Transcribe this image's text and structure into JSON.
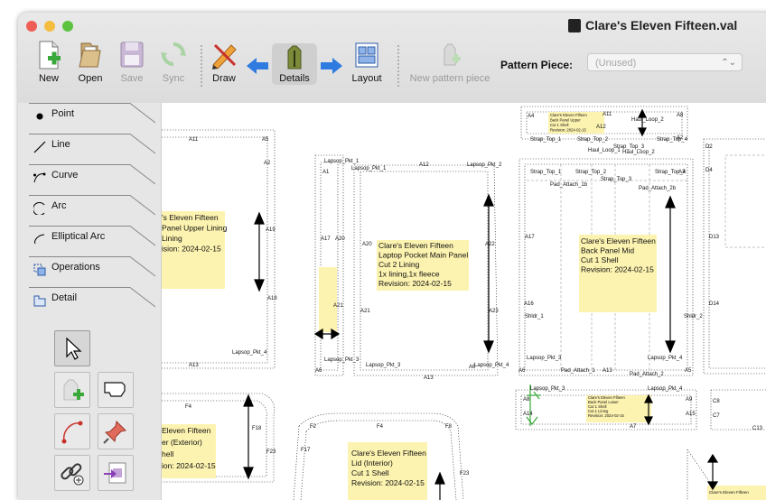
{
  "window": {
    "title": "Clare's Eleven Fifteen.val",
    "traffic": {
      "close": "#ee5e55",
      "minimize": "#f4bd3f",
      "zoom": "#5bc33f"
    }
  },
  "toolbar": {
    "new_label": "New",
    "open_label": "Open",
    "save_label": "Save",
    "sync_label": "Sync",
    "draw_label": "Draw",
    "details_label": "Details",
    "layout_label": "Layout",
    "new_piece_label": "New pattern piece",
    "pattern_piece_label": "Pattern Piece:",
    "pattern_piece_value": "(Unused)",
    "arrow_color": "#2f7be0"
  },
  "sidebar": {
    "tabs": [
      {
        "label": "Point",
        "icon": "point-icon"
      },
      {
        "label": "Line",
        "icon": "line-icon"
      },
      {
        "label": "Curve",
        "icon": "curve-icon"
      },
      {
        "label": "Arc",
        "icon": "arc-icon"
      },
      {
        "label": "Elliptical Arc",
        "icon": "elliptical-arc-icon"
      },
      {
        "label": "Operations",
        "icon": "operations-icon"
      },
      {
        "label": "Detail",
        "icon": "detail-icon"
      }
    ],
    "tools": [
      "pointer-arrow-icon",
      "add-piece-icon",
      "union-icon",
      "curve-path-icon",
      "pin-icon",
      "link-icon",
      "export-icon"
    ]
  },
  "canvas": {
    "note_color": "#fdf3b0",
    "pieces": [
      {
        "lines": [
          "'s Eleven Fifteen",
          "Panel Upper Lining",
          "Lining",
          "ision: 2024-02-15"
        ]
      },
      {
        "lines": [
          "Clare's Eleven Fifteen",
          "Laptop Pocket Main Panel",
          "Cut 2 Lining",
          "1x lining,1x fleece",
          "Revision: 2024-02-15"
        ]
      },
      {
        "lines": [
          "Clare's Eleven Fifteen",
          "Back Panel Mid",
          "Cut 1 Shell",
          "Revision: 2024-02-15"
        ]
      },
      {
        "lines": [
          "Clare's Eleven Fifteen",
          "Lid (Interior)",
          "Cut 1 Shell",
          "Revision: 2024-02-15"
        ]
      },
      {
        "lines": [
          "Eleven Fifteen",
          "er (Exterior)",
          "hell",
          "ion: 2024-02-15"
        ]
      },
      {
        "lines": [
          "Clare's Eleven Fifteen",
          "Back Panel Upper",
          "Cut 1 Shell",
          "Revision: 2024-02-15"
        ]
      },
      {
        "lines": [
          "Clare's Eleven Fifteen",
          "Back Panel Lower",
          "Cut 1 Shell",
          "Cut 1 Lining",
          "Revision: 2024-02-15"
        ]
      },
      {
        "lines": [
          "Clare's Eleven Fifteen"
        ]
      }
    ],
    "labels": {
      "a11": "A11",
      "a5": "A5",
      "a2": "A2",
      "a19": "A19",
      "a18": "A18",
      "a13": "A13",
      "lpk4": "Lapsop_Pkt_4",
      "pkt1": "Lapsop_Pkt_1",
      "a1": "A1",
      "a17": "A17",
      "a20": "A20",
      "a21": "A21",
      "pkt3": "Lapsop_Pkt_3",
      "a6": "A6",
      "pkt1b": "Lapsop_Pkt_1",
      "a12": "A12",
      "pkt2": "Lapsop_Pkt_2",
      "a20b": "A20",
      "a22": "A22",
      "a21b": "A21",
      "a23": "A23",
      "pkt3b": "Lapsop_Pkt_3",
      "a13b": "A13",
      "pkt4b": "Lapsop_Pkt_4",
      "a6b": "A6",
      "a4": "A4",
      "a11b": "A11",
      "a8": "A8",
      "hl2": "Haul_Loop_2",
      "st2": "Strap_Top_2",
      "hl1": "Haul_Loop_1",
      "st3": "Strap_Top_3",
      "hl2b": "Haul_Loop_2",
      "st4": "Strap_Top_4",
      "a12b": "A12",
      "st1": "Strap_Top_1",
      "a2b": "A2",
      "st1b": "Strap_Top_1",
      "st2b": "Strap_Top_2",
      "st4b": "Strap_Top_4",
      "a3": "A3",
      "st3b": "Strap_Top_3",
      "pa1b": "Pad_Attach_1b",
      "pa2b": "Pad_Attach_2b",
      "a17b": "A17",
      "a16": "A16",
      "shl1": "Shldr_1",
      "pkt3c": "Lapsop_Pkt_3",
      "pkt4c": "Lapsop_Pkt_4",
      "a6c": "A6",
      "pa1": "Pad_Attach_1",
      "a13c": "A13",
      "pa2": "Pad_Attach_2",
      "a5b": "A5",
      "d2": "D2",
      "d4": "D4",
      "d13": "D13",
      "d14": "D14",
      "shl2": "Shldr_2",
      "a8b": "A8",
      "a9": "A9",
      "a14": "A14",
      "a15": "A15",
      "a7": "A7",
      "pkt3d": "Lapsop_Pkt_3",
      "pkt4d": "Lapsop_Pkt_4",
      "c8": "C8",
      "c7": "C7",
      "c13": "C13",
      "f4": "F4",
      "f18": "F18",
      "f23": "F23",
      "f2": "F2",
      "f4b": "F4",
      "f8": "F8",
      "f17": "F17",
      "f23b": "F23"
    }
  }
}
